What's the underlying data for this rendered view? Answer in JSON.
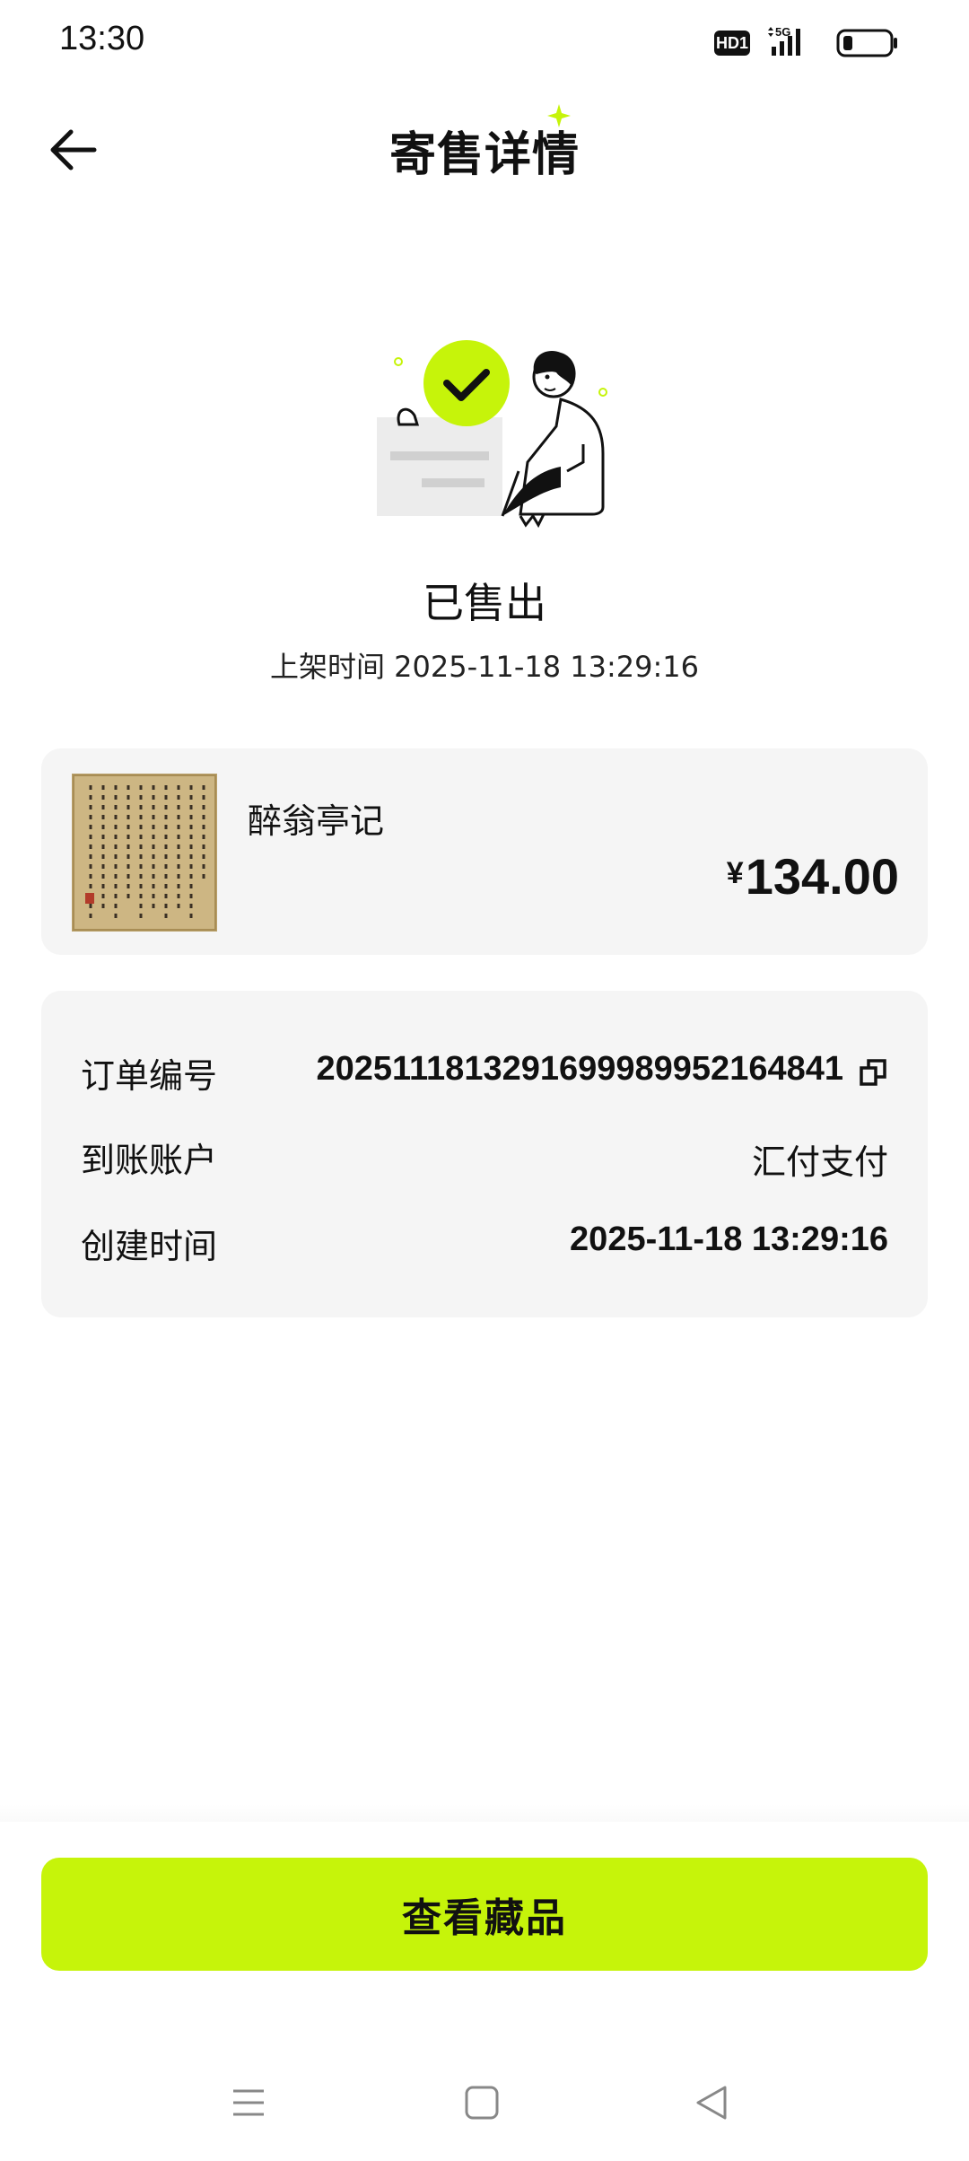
{
  "status_bar": {
    "time": "13:30",
    "hd_label": "HD1",
    "network": "5G",
    "icons": [
      "hd-icon",
      "signal-5g-icon",
      "battery-icon"
    ]
  },
  "header": {
    "back_icon": "arrow-left-icon",
    "title": "寄售详情"
  },
  "status": {
    "illustration": "person-holding-document-with-check-illustration",
    "title": "已售出",
    "listing_time": "上架时间 2025-11-18 13:29:16"
  },
  "product": {
    "name": "醉翁亭记",
    "currency": "¥",
    "price": "134.00",
    "thumbnail": "calligraphy-scroll-thumbnail"
  },
  "order_info": {
    "order_number_label": "订单编号",
    "order_number_value": "2025111813291699989952164841",
    "copy_icon": "copy-icon",
    "account_label": "到账账户",
    "account_value": "汇付支付",
    "created_label": "创建时间",
    "created_value": "2025-11-18 13:29:16"
  },
  "actions": {
    "view_collection_label": "查看藏品"
  },
  "colors": {
    "accent": "#c6f40a",
    "card_bg": "#f5f5f5",
    "text": "#111111"
  },
  "nav_bar": {
    "icons": [
      "menu-icon",
      "home-square-icon",
      "back-triangle-icon"
    ]
  }
}
